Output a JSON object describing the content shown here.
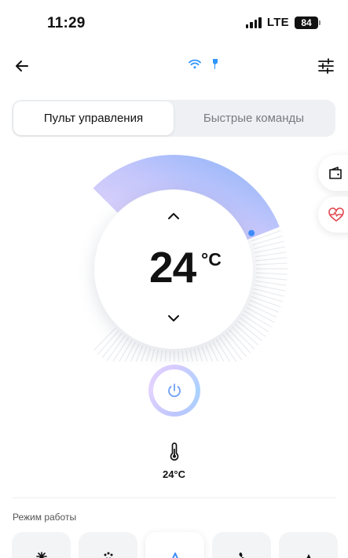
{
  "status_bar": {
    "time": "11:29",
    "network": "LTE",
    "battery": "84"
  },
  "header": {
    "back_icon": "arrow-left-icon",
    "wifi_icon": "wifi-icon",
    "bluetooth_icon": "bluetooth-icon",
    "settings_icon": "sliders-icon"
  },
  "tabs": [
    {
      "label": "Пульт управления",
      "active": true
    },
    {
      "label": "Быстрые команды",
      "active": false
    }
  ],
  "side_buttons": [
    {
      "icon": "wallet-icon"
    },
    {
      "icon": "heart-pulse-icon"
    }
  ],
  "thermostat": {
    "target_temperature": "24",
    "unit": "°C",
    "level": 0.42
  },
  "power": {
    "icon": "power-icon"
  },
  "room": {
    "icon": "thermometer-icon",
    "temperature": "24°C"
  },
  "modes": {
    "label": "Режим работы",
    "items": [
      {
        "icon": "snowflake-icon"
      },
      {
        "icon": "dry-icon"
      },
      {
        "icon": "auto-icon",
        "active": true
      },
      {
        "icon": "fan-icon"
      },
      {
        "icon": "heat-icon"
      }
    ]
  },
  "colors": {
    "accent_blue": "#3f8cff",
    "arc_start": "#e3d4fb",
    "arc_end": "#8fb6fb",
    "segmented_bg": "#eef0f3",
    "heart_red": "#e2474f"
  }
}
